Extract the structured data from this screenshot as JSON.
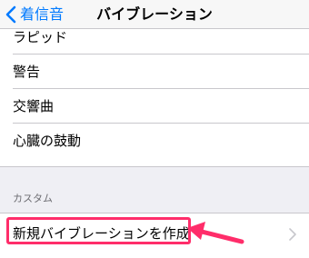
{
  "navbar": {
    "back_label": "着信音",
    "title": "バイブレーション"
  },
  "standard_list": {
    "items": [
      {
        "label": "ラピッド"
      },
      {
        "label": "警告"
      },
      {
        "label": "交響曲"
      },
      {
        "label": "心臓の鼓動"
      }
    ]
  },
  "custom_section": {
    "header": "カスタム",
    "create_label": "新規バイブレーションを作成"
  },
  "colors": {
    "accent": "#007aff",
    "highlight": "#ff2d6a",
    "background": "#efeff4"
  },
  "icons": {
    "back": "chevron-left-icon",
    "disclosure": "chevron-right-icon",
    "annotation": "pointer-arrow-icon"
  }
}
